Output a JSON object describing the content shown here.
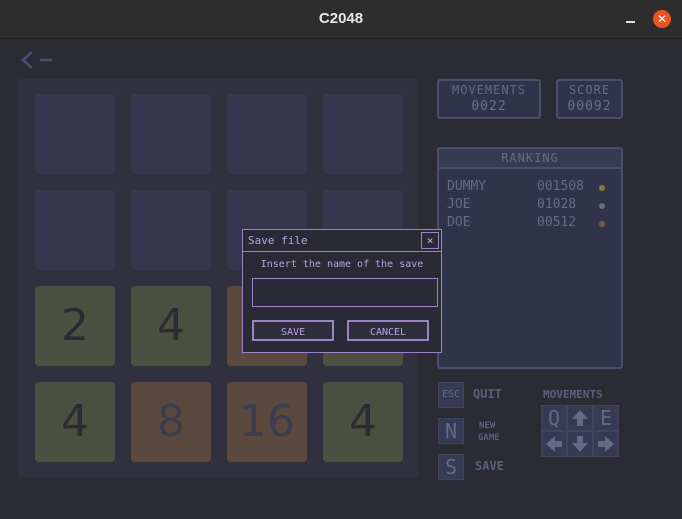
{
  "window": {
    "title": "C2048"
  },
  "board": {
    "tiles": [
      "",
      "",
      "",
      "",
      "",
      "",
      "",
      "",
      "2",
      "4",
      "",
      "",
      "4",
      "8",
      "16",
      "4"
    ]
  },
  "stats": {
    "movements_label": "MOVEMENTS",
    "movements_value": "0022",
    "score_label": "SCORE",
    "score_value": "00092"
  },
  "ranking": {
    "title": "RANKING",
    "rows": [
      {
        "name": "DUMMY",
        "score": "001508",
        "medal_color": "#8a7a3a"
      },
      {
        "name": "JOE",
        "score": "01028",
        "medal_color": "#6a6e80"
      },
      {
        "name": "DOE",
        "score": "00512",
        "medal_color": "#7a5a30"
      }
    ]
  },
  "controls": {
    "esc_key": "ESC",
    "quit_label": "QUIT",
    "n_key": "N",
    "new_game_label_1": "NEW",
    "new_game_label_2": "GAME",
    "s_key": "S",
    "save_label": "SAVE",
    "movements_title": "MOVEMENTS",
    "q_key": "Q",
    "e_key": "E"
  },
  "dialog": {
    "title": "Save file",
    "close_symbol": "×",
    "prompt": "Insert the name of the save",
    "input_value": "",
    "save_button": "SAVE",
    "cancel_button": "CANCEL"
  }
}
